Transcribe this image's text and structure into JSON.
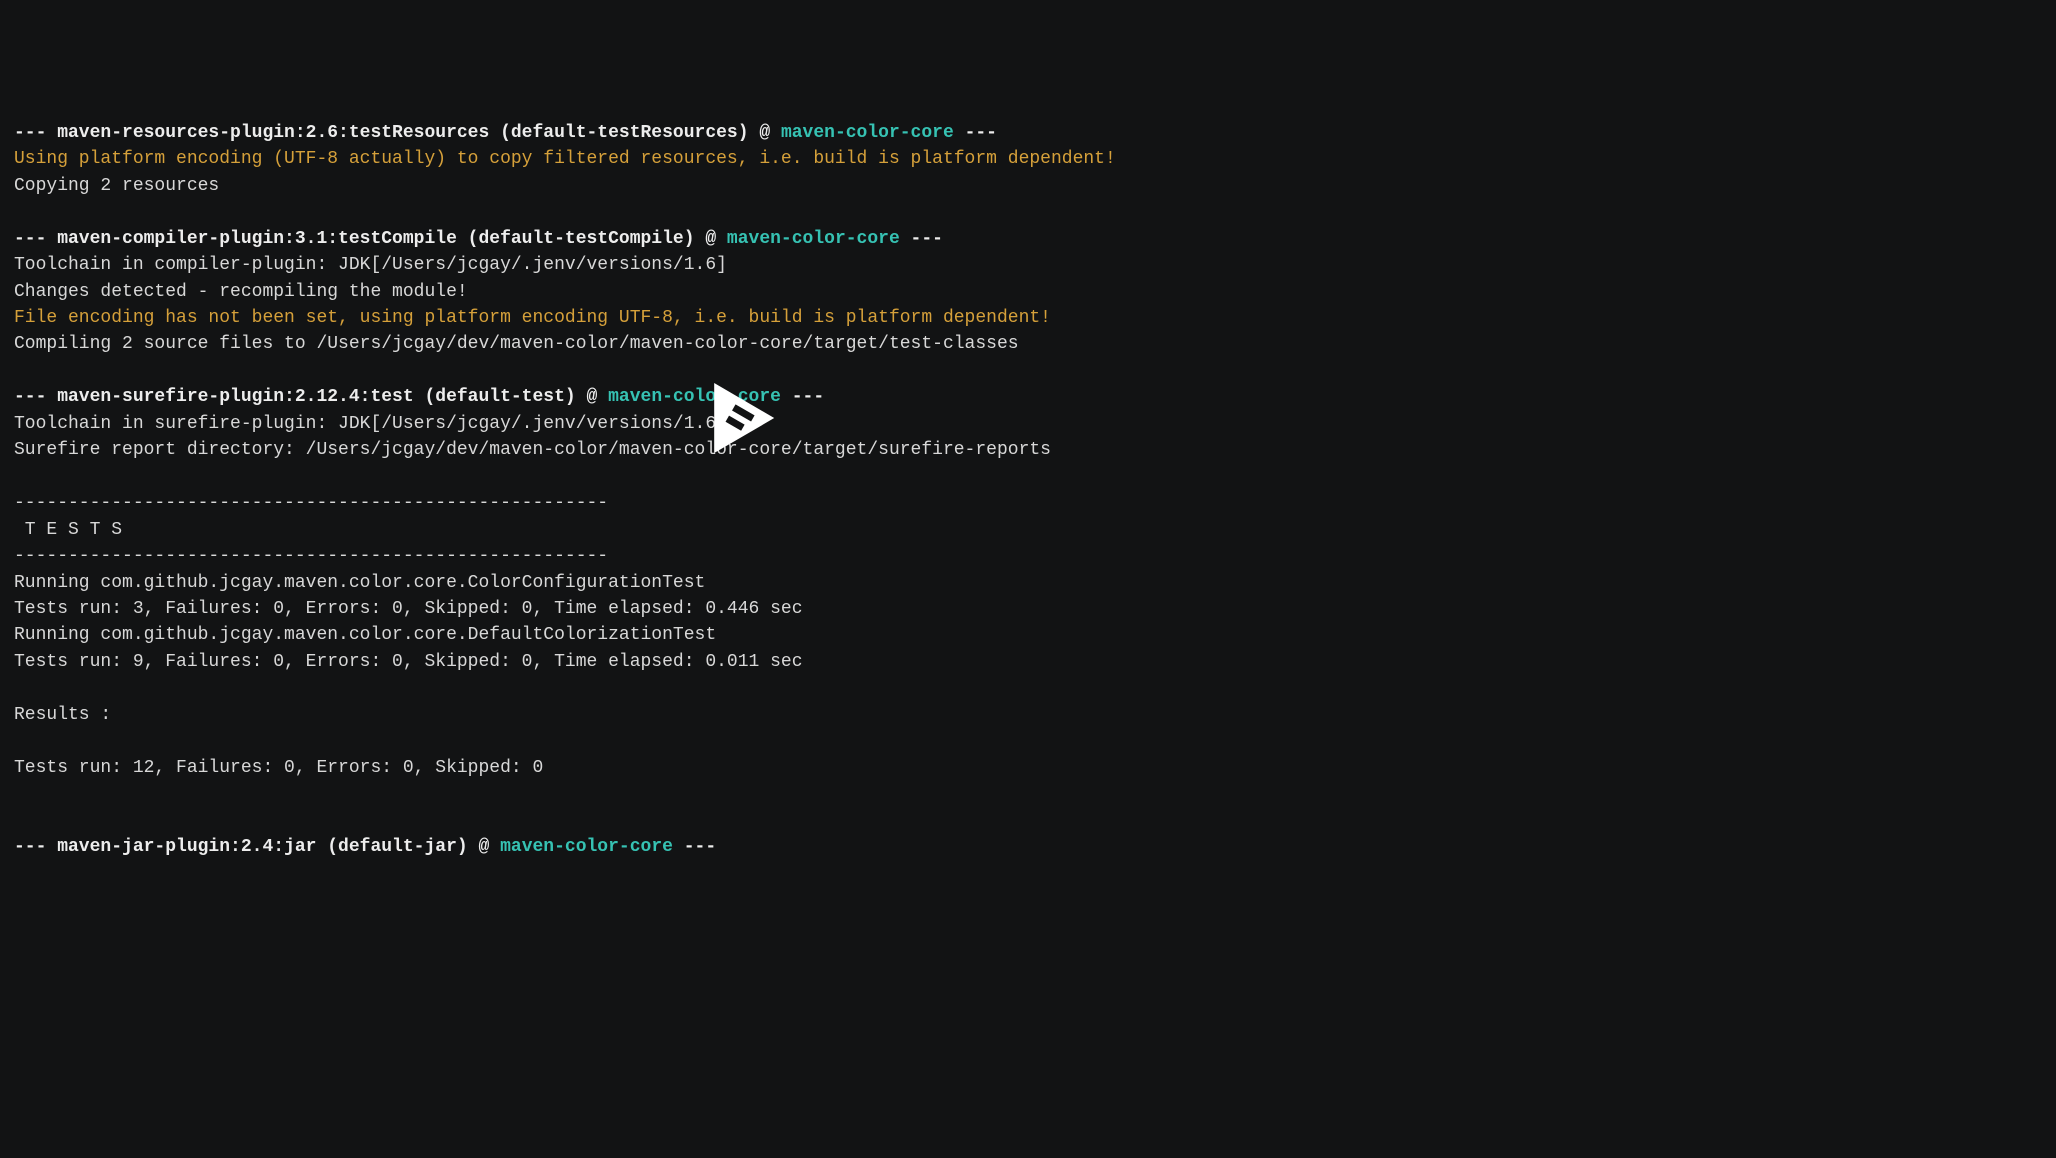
{
  "lines": [
    {
      "segments": [
        {
          "class": "bold",
          "text": "--- maven-resources-plugin:2.6:testResources (default-testResources) @ "
        },
        {
          "class": "cyan",
          "text": "maven-color-core"
        },
        {
          "class": "bold",
          "text": " ---"
        }
      ]
    },
    {
      "segments": [
        {
          "class": "yellow",
          "text": "Using platform encoding (UTF-8 actually) to copy filtered resources, i.e. build is platform dependent!"
        }
      ]
    },
    {
      "segments": [
        {
          "class": "white",
          "text": "Copying 2 resources"
        }
      ]
    },
    {
      "blank": true
    },
    {
      "segments": [
        {
          "class": "bold",
          "text": "--- maven-compiler-plugin:3.1:testCompile (default-testCompile) @ "
        },
        {
          "class": "cyan",
          "text": "maven-color-core"
        },
        {
          "class": "bold",
          "text": " ---"
        }
      ]
    },
    {
      "segments": [
        {
          "class": "white",
          "text": "Toolchain in compiler-plugin: JDK[/Users/jcgay/.jenv/versions/1.6]"
        }
      ]
    },
    {
      "segments": [
        {
          "class": "white",
          "text": "Changes detected - recompiling the module!"
        }
      ]
    },
    {
      "segments": [
        {
          "class": "yellow",
          "text": "File encoding has not been set, using platform encoding UTF-8, i.e. build is platform dependent!"
        }
      ]
    },
    {
      "segments": [
        {
          "class": "white",
          "text": "Compiling 2 source files to /Users/jcgay/dev/maven-color/maven-color-core/target/test-classes"
        }
      ]
    },
    {
      "blank": true
    },
    {
      "segments": [
        {
          "class": "bold",
          "text": "--- maven-surefire-plugin:2.12.4:test (default-test) @ "
        },
        {
          "class": "cyan",
          "text": "maven-color-core"
        },
        {
          "class": "bold",
          "text": " ---"
        }
      ]
    },
    {
      "segments": [
        {
          "class": "white",
          "text": "Toolchain in surefire-plugin: JDK[/Users/jcgay/.jenv/versions/1.6]"
        }
      ]
    },
    {
      "segments": [
        {
          "class": "white",
          "text": "Surefire report directory: /Users/jcgay/dev/maven-color/maven-color-core/target/surefire-reports"
        }
      ]
    },
    {
      "blank": true
    },
    {
      "segments": [
        {
          "class": "white",
          "text": "-------------------------------------------------------"
        }
      ]
    },
    {
      "segments": [
        {
          "class": "white",
          "text": " T E S T S"
        }
      ]
    },
    {
      "segments": [
        {
          "class": "white",
          "text": "-------------------------------------------------------"
        }
      ]
    },
    {
      "segments": [
        {
          "class": "white",
          "text": "Running com.github.jcgay.maven.color.core.ColorConfigurationTest"
        }
      ]
    },
    {
      "segments": [
        {
          "class": "white",
          "text": "Tests run: 3, Failures: 0, Errors: 0, Skipped: 0, Time elapsed: 0.446 sec"
        }
      ]
    },
    {
      "segments": [
        {
          "class": "white",
          "text": "Running com.github.jcgay.maven.color.core.DefaultColorizationTest"
        }
      ]
    },
    {
      "segments": [
        {
          "class": "white",
          "text": "Tests run: 9, Failures: 0, Errors: 0, Skipped: 0, Time elapsed: 0.011 sec"
        }
      ]
    },
    {
      "blank": true
    },
    {
      "segments": [
        {
          "class": "white",
          "text": "Results :"
        }
      ]
    },
    {
      "blank": true
    },
    {
      "segments": [
        {
          "class": "white",
          "text": "Tests run: 12, Failures: 0, Errors: 0, Skipped: 0"
        }
      ]
    },
    {
      "blank": true
    },
    {
      "blank": true
    },
    {
      "segments": [
        {
          "class": "bold",
          "text": "--- maven-jar-plugin:2.4:jar (default-jar) @ "
        },
        {
          "class": "cyan",
          "text": "maven-color-core"
        },
        {
          "class": "bold",
          "text": " ---"
        }
      ]
    }
  ]
}
